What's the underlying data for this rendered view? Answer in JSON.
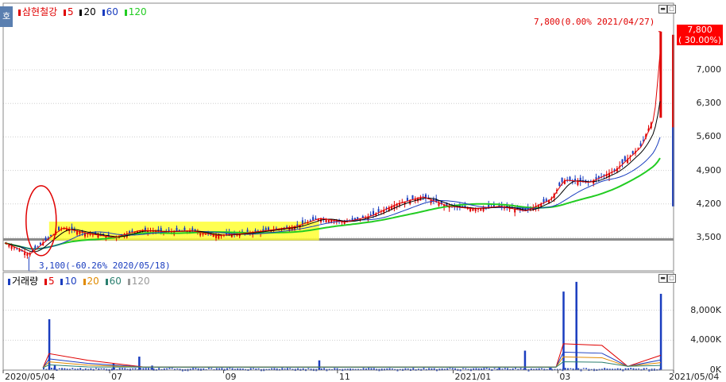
{
  "header": {
    "side_tab_label": "호",
    "price_legend": [
      {
        "label": "삼현철강",
        "color": "#e00000"
      },
      {
        "label": "5",
        "color": "#e00000"
      },
      {
        "label": "20",
        "color": "#000000"
      },
      {
        "label": "60",
        "color": "#1a3dbf"
      },
      {
        "label": "120",
        "color": "#22cc22"
      }
    ],
    "volume_legend": [
      {
        "label": "거래량",
        "color": "#1a3dbf"
      },
      {
        "label": "5",
        "color": "#e00000"
      },
      {
        "label": "10",
        "color": "#1a3dbf"
      },
      {
        "label": "20",
        "color": "#e08a00"
      },
      {
        "label": "60",
        "color": "#2a7f6f"
      },
      {
        "label": "120",
        "color": "#999999"
      }
    ]
  },
  "annotations": {
    "max_label": "7,800(0.00% 2021/04/27)",
    "min_label": "3,100(-60.26% 2020/05/18)",
    "current_price": "7,800",
    "current_change": "( 30.00%)"
  },
  "chart_data": [
    {
      "type": "candlestick",
      "title": "삼현철강",
      "x_range": [
        "2020/05/04",
        "2021/05/04"
      ],
      "x_tick_labels": [
        "2020/05/04",
        "07",
        "09",
        "11",
        "2021/01",
        "03",
        "2021/05/04"
      ],
      "y_tick_labels": [
        "7,000",
        "6,300",
        "5,600",
        "4,900",
        "4,200",
        "3,500"
      ],
      "y_ticks": [
        7000,
        6300,
        5600,
        4900,
        4200,
        3500
      ],
      "ylim": [
        3000,
        8100
      ],
      "reference_price": 3450,
      "max": {
        "value": 7800,
        "date": "2021/04/27"
      },
      "min": {
        "value": 3100,
        "date": "2020/05/18"
      },
      "close_series": [
        {
          "date": "2020/05/04",
          "close": 3400
        },
        {
          "date": "2020/05/18",
          "close": 3150
        },
        {
          "date": "2020/05/29",
          "close": 3500
        },
        {
          "date": "2020/06/05",
          "close": 3700
        },
        {
          "date": "2020/06/19",
          "close": 3580
        },
        {
          "date": "2020/07/03",
          "close": 3500
        },
        {
          "date": "2020/07/17",
          "close": 3650
        },
        {
          "date": "2020/07/31",
          "close": 3620
        },
        {
          "date": "2020/08/14",
          "close": 3640
        },
        {
          "date": "2020/08/28",
          "close": 3540
        },
        {
          "date": "2020/09/11",
          "close": 3580
        },
        {
          "date": "2020/09/25",
          "close": 3650
        },
        {
          "date": "2020/10/09",
          "close": 3720
        },
        {
          "date": "2020/10/23",
          "close": 3900
        },
        {
          "date": "2020/11/06",
          "close": 3820
        },
        {
          "date": "2020/11/20",
          "close": 3950
        },
        {
          "date": "2020/12/04",
          "close": 4200
        },
        {
          "date": "2020/12/18",
          "close": 4350
        },
        {
          "date": "2021/01/01",
          "close": 4150
        },
        {
          "date": "2021/01/15",
          "close": 4100
        },
        {
          "date": "2021/01/29",
          "close": 4150
        },
        {
          "date": "2021/02/12",
          "close": 4050
        },
        {
          "date": "2021/02/26",
          "close": 4300
        },
        {
          "date": "2021/03/05",
          "close": 4700
        },
        {
          "date": "2021/03/19",
          "close": 4650
        },
        {
          "date": "2021/04/02",
          "close": 4900
        },
        {
          "date": "2021/04/09",
          "close": 5150
        },
        {
          "date": "2021/04/16",
          "close": 5400
        },
        {
          "date": "2021/04/23",
          "close": 6000
        },
        {
          "date": "2021/04/27",
          "close": 7800
        }
      ],
      "series": [
        {
          "name": "5",
          "color": "#e00000"
        },
        {
          "name": "20",
          "color": "#000000"
        },
        {
          "name": "60",
          "color": "#1a3dbf"
        },
        {
          "name": "120",
          "color": "#22cc22"
        }
      ]
    },
    {
      "type": "bar",
      "title": "거래량",
      "y_tick_labels": [
        "8,000K",
        "4,000K",
        "0K"
      ],
      "y_ticks": [
        8000,
        4000,
        0
      ],
      "ylim": [
        0,
        12000
      ],
      "bars": [
        {
          "date": "2020/05/29",
          "value": 6800
        },
        {
          "date": "2020/06/01",
          "value": 700
        },
        {
          "date": "2020/07/03",
          "value": 900
        },
        {
          "date": "2020/07/17",
          "value": 1800
        },
        {
          "date": "2020/07/24",
          "value": 600
        },
        {
          "date": "2020/10/23",
          "value": 1300
        },
        {
          "date": "2021/01/29",
          "value": 300
        },
        {
          "date": "2021/02/12",
          "value": 2600
        },
        {
          "date": "2021/02/26",
          "value": 300
        },
        {
          "date": "2021/03/05",
          "value": 10500
        },
        {
          "date": "2021/03/12",
          "value": 11800
        },
        {
          "date": "2021/04/27",
          "value": 10200
        }
      ]
    }
  ]
}
